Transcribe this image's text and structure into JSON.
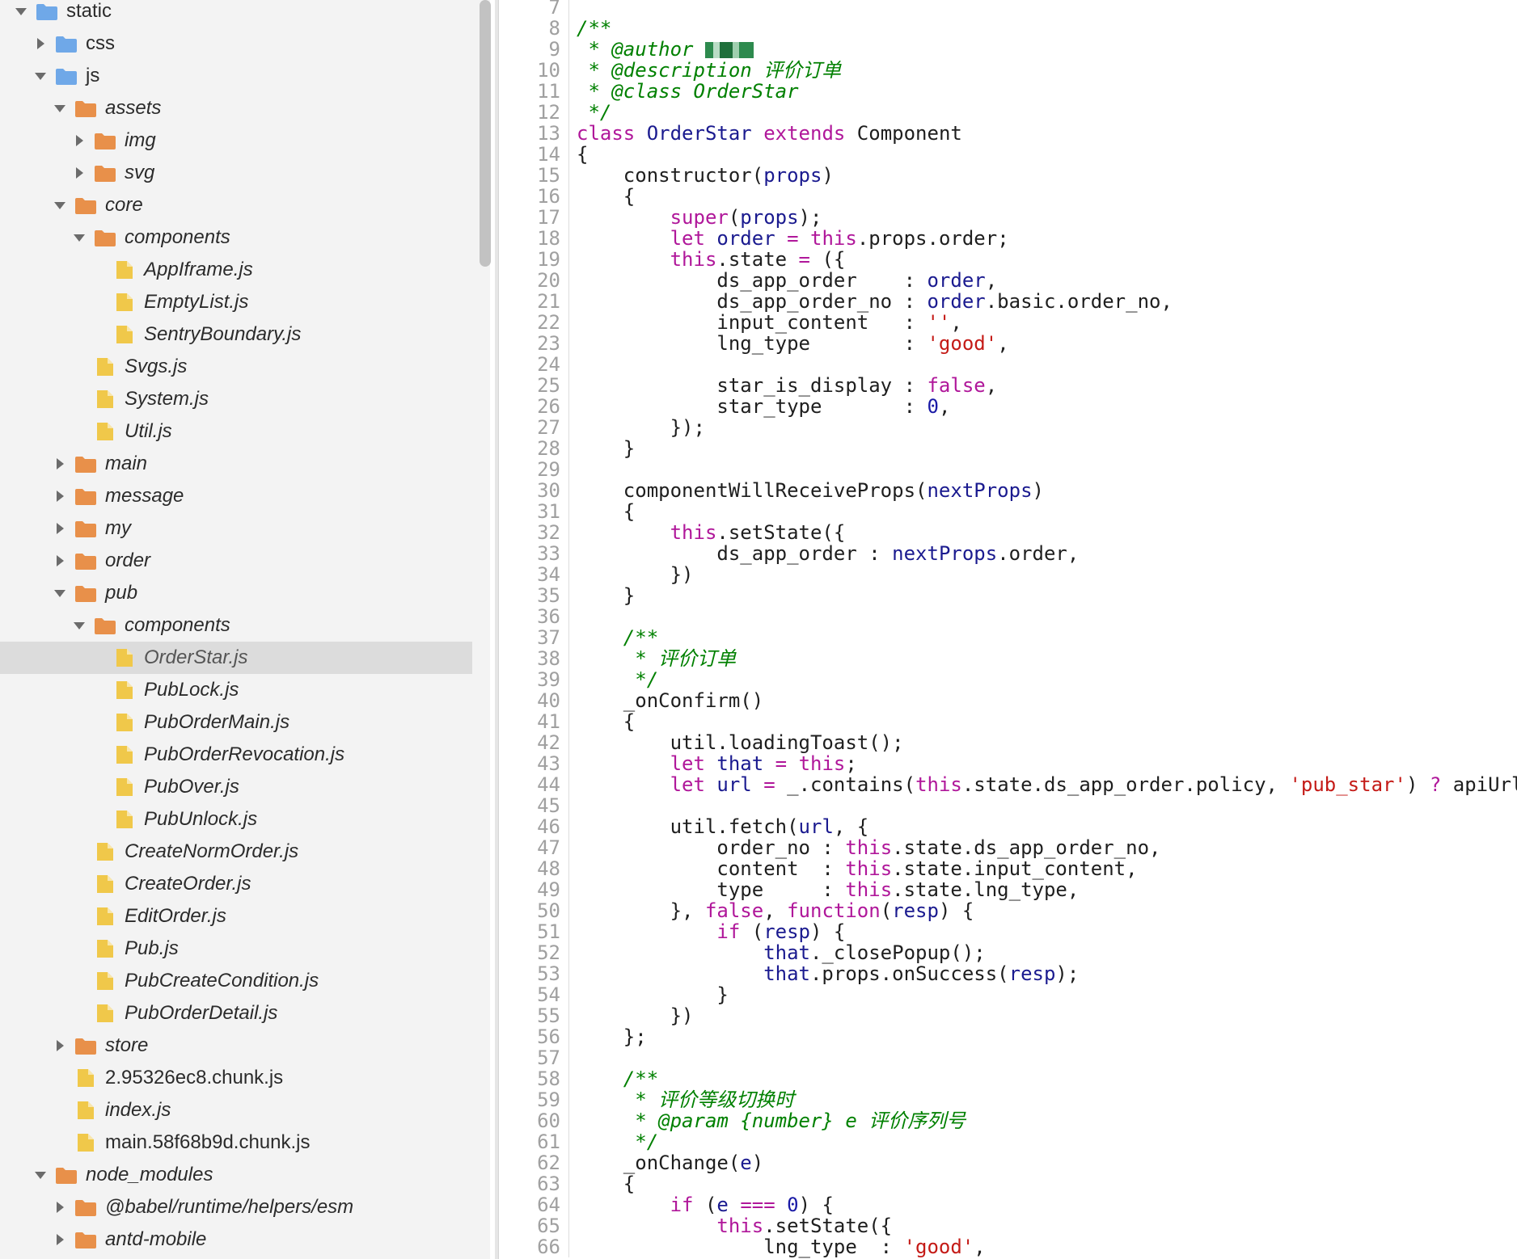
{
  "colors": {
    "folder_blue": "#6fa8e8",
    "folder_orange": "#e8904a",
    "file_yellow": "#f0c84a",
    "comment": "#008000",
    "keyword": "#b0179a",
    "identifier_blue": "#1a1a8f",
    "string": "#c41a16",
    "line_number": "#a0a0a0"
  },
  "file_tree": [
    {
      "label": "static",
      "depth": 0,
      "type": "folder",
      "color": "blue",
      "expanded": true,
      "italic": false
    },
    {
      "label": "css",
      "depth": 1,
      "type": "folder",
      "color": "blue",
      "expanded": false,
      "italic": false
    },
    {
      "label": "js",
      "depth": 1,
      "type": "folder",
      "color": "blue",
      "expanded": true,
      "italic": false
    },
    {
      "label": "assets",
      "depth": 2,
      "type": "folder",
      "color": "orange",
      "expanded": true,
      "italic": true
    },
    {
      "label": "img",
      "depth": 3,
      "type": "folder",
      "color": "orange",
      "expanded": false,
      "italic": true
    },
    {
      "label": "svg",
      "depth": 3,
      "type": "folder",
      "color": "orange",
      "expanded": false,
      "italic": true
    },
    {
      "label": "core",
      "depth": 2,
      "type": "folder",
      "color": "orange",
      "expanded": true,
      "italic": true
    },
    {
      "label": "components",
      "depth": 3,
      "type": "folder",
      "color": "orange",
      "expanded": true,
      "italic": true
    },
    {
      "label": "AppIframe.js",
      "depth": 4,
      "type": "file",
      "italic": true
    },
    {
      "label": "EmptyList.js",
      "depth": 4,
      "type": "file",
      "italic": true
    },
    {
      "label": "SentryBoundary.js",
      "depth": 4,
      "type": "file",
      "italic": true
    },
    {
      "label": "Svgs.js",
      "depth": 3,
      "type": "file",
      "italic": true
    },
    {
      "label": "System.js",
      "depth": 3,
      "type": "file",
      "italic": true
    },
    {
      "label": "Util.js",
      "depth": 3,
      "type": "file",
      "italic": true
    },
    {
      "label": "main",
      "depth": 2,
      "type": "folder",
      "color": "orange",
      "expanded": false,
      "italic": true
    },
    {
      "label": "message",
      "depth": 2,
      "type": "folder",
      "color": "orange",
      "expanded": false,
      "italic": true
    },
    {
      "label": "my",
      "depth": 2,
      "type": "folder",
      "color": "orange",
      "expanded": false,
      "italic": true
    },
    {
      "label": "order",
      "depth": 2,
      "type": "folder",
      "color": "orange",
      "expanded": false,
      "italic": true
    },
    {
      "label": "pub",
      "depth": 2,
      "type": "folder",
      "color": "orange",
      "expanded": true,
      "italic": true
    },
    {
      "label": "components",
      "depth": 3,
      "type": "folder",
      "color": "orange",
      "expanded": true,
      "italic": true
    },
    {
      "label": "OrderStar.js",
      "depth": 4,
      "type": "file",
      "italic": true,
      "selected": true
    },
    {
      "label": "PubLock.js",
      "depth": 4,
      "type": "file",
      "italic": true
    },
    {
      "label": "PubOrderMain.js",
      "depth": 4,
      "type": "file",
      "italic": true
    },
    {
      "label": "PubOrderRevocation.js",
      "depth": 4,
      "type": "file",
      "italic": true
    },
    {
      "label": "PubOver.js",
      "depth": 4,
      "type": "file",
      "italic": true
    },
    {
      "label": "PubUnlock.js",
      "depth": 4,
      "type": "file",
      "italic": true
    },
    {
      "label": "CreateNormOrder.js",
      "depth": 3,
      "type": "file",
      "italic": true
    },
    {
      "label": "CreateOrder.js",
      "depth": 3,
      "type": "file",
      "italic": true
    },
    {
      "label": "EditOrder.js",
      "depth": 3,
      "type": "file",
      "italic": true
    },
    {
      "label": "Pub.js",
      "depth": 3,
      "type": "file",
      "italic": true
    },
    {
      "label": "PubCreateCondition.js",
      "depth": 3,
      "type": "file",
      "italic": true
    },
    {
      "label": "PubOrderDetail.js",
      "depth": 3,
      "type": "file",
      "italic": true
    },
    {
      "label": "store",
      "depth": 2,
      "type": "folder",
      "color": "orange",
      "expanded": false,
      "italic": true
    },
    {
      "label": "2.95326ec8.chunk.js",
      "depth": 2,
      "type": "file",
      "italic": false
    },
    {
      "label": "index.js",
      "depth": 2,
      "type": "file",
      "italic": true
    },
    {
      "label": "main.58f68b9d.chunk.js",
      "depth": 2,
      "type": "file",
      "italic": false
    },
    {
      "label": "node_modules",
      "depth": 1,
      "type": "folder",
      "color": "orange",
      "expanded": true,
      "italic": true
    },
    {
      "label": "@babel/runtime/helpers/esm",
      "depth": 2,
      "type": "folder",
      "color": "orange",
      "expanded": false,
      "italic": true
    },
    {
      "label": "antd-mobile",
      "depth": 2,
      "type": "folder",
      "color": "orange",
      "expanded": false,
      "italic": true
    }
  ],
  "code_lines": [
    {
      "n": "7",
      "tokens": []
    },
    {
      "n": "8",
      "tokens": [
        {
          "t": "cm",
          "v": "/**"
        }
      ]
    },
    {
      "n": "9",
      "tokens": [
        {
          "t": "cm",
          "v": " * @author "
        },
        {
          "t": "redact",
          "v": ""
        }
      ]
    },
    {
      "n": "10",
      "tokens": [
        {
          "t": "cm",
          "v": " * @description 评价订单"
        }
      ]
    },
    {
      "n": "11",
      "tokens": [
        {
          "t": "cm",
          "v": " * @class OrderStar"
        }
      ]
    },
    {
      "n": "12",
      "tokens": [
        {
          "t": "cm",
          "v": " */"
        }
      ]
    },
    {
      "n": "13",
      "tokens": [
        {
          "t": "kw",
          "v": "class"
        },
        {
          "t": "pl",
          "v": " "
        },
        {
          "t": "fn",
          "v": "OrderStar"
        },
        {
          "t": "pl",
          "v": " "
        },
        {
          "t": "kw",
          "v": "extends"
        },
        {
          "t": "pl",
          "v": " Component"
        }
      ]
    },
    {
      "n": "14",
      "tokens": [
        {
          "t": "pl",
          "v": "{"
        }
      ]
    },
    {
      "n": "15",
      "tokens": [
        {
          "t": "pl",
          "v": "    constructor("
        },
        {
          "t": "fn",
          "v": "props"
        },
        {
          "t": "pl",
          "v": ")"
        }
      ]
    },
    {
      "n": "16",
      "tokens": [
        {
          "t": "pl",
          "v": "    {"
        }
      ]
    },
    {
      "n": "17",
      "tokens": [
        {
          "t": "pl",
          "v": "        "
        },
        {
          "t": "kw",
          "v": "super"
        },
        {
          "t": "pl",
          "v": "("
        },
        {
          "t": "fn",
          "v": "props"
        },
        {
          "t": "pl",
          "v": ");"
        }
      ]
    },
    {
      "n": "18",
      "tokens": [
        {
          "t": "pl",
          "v": "        "
        },
        {
          "t": "kw",
          "v": "let"
        },
        {
          "t": "pl",
          "v": " "
        },
        {
          "t": "fn",
          "v": "order"
        },
        {
          "t": "pl",
          "v": " "
        },
        {
          "t": "op",
          "v": "="
        },
        {
          "t": "pl",
          "v": " "
        },
        {
          "t": "kw",
          "v": "this"
        },
        {
          "t": "pl",
          "v": ".props.order;"
        }
      ]
    },
    {
      "n": "19",
      "tokens": [
        {
          "t": "pl",
          "v": "        "
        },
        {
          "t": "kw",
          "v": "this"
        },
        {
          "t": "pl",
          "v": ".state "
        },
        {
          "t": "op",
          "v": "="
        },
        {
          "t": "pl",
          "v": " ({"
        }
      ]
    },
    {
      "n": "20",
      "tokens": [
        {
          "t": "pl",
          "v": "            ds_app_order    : "
        },
        {
          "t": "fn",
          "v": "order"
        },
        {
          "t": "pl",
          "v": ","
        }
      ]
    },
    {
      "n": "21",
      "tokens": [
        {
          "t": "pl",
          "v": "            ds_app_order_no : "
        },
        {
          "t": "fn",
          "v": "order"
        },
        {
          "t": "pl",
          "v": ".basic.order_no,"
        }
      ]
    },
    {
      "n": "22",
      "tokens": [
        {
          "t": "pl",
          "v": "            input_content   : "
        },
        {
          "t": "st",
          "v": "''"
        },
        {
          "t": "pl",
          "v": ","
        }
      ]
    },
    {
      "n": "23",
      "tokens": [
        {
          "t": "pl",
          "v": "            lng_type        : "
        },
        {
          "t": "st",
          "v": "'good'"
        },
        {
          "t": "pl",
          "v": ","
        }
      ]
    },
    {
      "n": "24",
      "tokens": []
    },
    {
      "n": "25",
      "tokens": [
        {
          "t": "pl",
          "v": "            star_is_display : "
        },
        {
          "t": "kw",
          "v": "false"
        },
        {
          "t": "pl",
          "v": ","
        }
      ]
    },
    {
      "n": "26",
      "tokens": [
        {
          "t": "pl",
          "v": "            star_type       : "
        },
        {
          "t": "nm",
          "v": "0"
        },
        {
          "t": "pl",
          "v": ","
        }
      ]
    },
    {
      "n": "27",
      "tokens": [
        {
          "t": "pl",
          "v": "        });"
        }
      ]
    },
    {
      "n": "28",
      "tokens": [
        {
          "t": "pl",
          "v": "    }"
        }
      ]
    },
    {
      "n": "29",
      "tokens": []
    },
    {
      "n": "30",
      "tokens": [
        {
          "t": "pl",
          "v": "    componentWillReceiveProps("
        },
        {
          "t": "fn",
          "v": "nextProps"
        },
        {
          "t": "pl",
          "v": ")"
        }
      ]
    },
    {
      "n": "31",
      "tokens": [
        {
          "t": "pl",
          "v": "    {"
        }
      ]
    },
    {
      "n": "32",
      "tokens": [
        {
          "t": "pl",
          "v": "        "
        },
        {
          "t": "kw",
          "v": "this"
        },
        {
          "t": "pl",
          "v": ".setState({"
        }
      ]
    },
    {
      "n": "33",
      "tokens": [
        {
          "t": "pl",
          "v": "            ds_app_order : "
        },
        {
          "t": "fn",
          "v": "nextProps"
        },
        {
          "t": "pl",
          "v": ".order,"
        }
      ]
    },
    {
      "n": "34",
      "tokens": [
        {
          "t": "pl",
          "v": "        })"
        }
      ]
    },
    {
      "n": "35",
      "tokens": [
        {
          "t": "pl",
          "v": "    }"
        }
      ]
    },
    {
      "n": "36",
      "tokens": []
    },
    {
      "n": "37",
      "tokens": [
        {
          "t": "cm",
          "v": "    /**"
        }
      ]
    },
    {
      "n": "38",
      "tokens": [
        {
          "t": "cm",
          "v": "     * 评价订单"
        }
      ]
    },
    {
      "n": "39",
      "tokens": [
        {
          "t": "cm",
          "v": "     */"
        }
      ]
    },
    {
      "n": "40",
      "tokens": [
        {
          "t": "pl",
          "v": "    _onConfirm()"
        }
      ]
    },
    {
      "n": "41",
      "tokens": [
        {
          "t": "pl",
          "v": "    {"
        }
      ]
    },
    {
      "n": "42",
      "tokens": [
        {
          "t": "pl",
          "v": "        util.loadingToast();"
        }
      ]
    },
    {
      "n": "43",
      "tokens": [
        {
          "t": "pl",
          "v": "        "
        },
        {
          "t": "kw",
          "v": "let"
        },
        {
          "t": "pl",
          "v": " "
        },
        {
          "t": "fn",
          "v": "that"
        },
        {
          "t": "pl",
          "v": " "
        },
        {
          "t": "op",
          "v": "="
        },
        {
          "t": "pl",
          "v": " "
        },
        {
          "t": "kw",
          "v": "this"
        },
        {
          "t": "pl",
          "v": ";"
        }
      ]
    },
    {
      "n": "44",
      "tokens": [
        {
          "t": "pl",
          "v": "        "
        },
        {
          "t": "kw",
          "v": "let"
        },
        {
          "t": "pl",
          "v": " "
        },
        {
          "t": "fn",
          "v": "url"
        },
        {
          "t": "pl",
          "v": " "
        },
        {
          "t": "op",
          "v": "="
        },
        {
          "t": "pl",
          "v": " _.contains("
        },
        {
          "t": "kw",
          "v": "this"
        },
        {
          "t": "pl",
          "v": ".state.ds_app_order.policy, "
        },
        {
          "t": "st",
          "v": "'pub_star'"
        },
        {
          "t": "pl",
          "v": ") "
        },
        {
          "t": "op",
          "v": "?"
        },
        {
          "t": "pl",
          "v": " apiUrl"
        }
      ]
    },
    {
      "n": "45",
      "tokens": []
    },
    {
      "n": "46",
      "tokens": [
        {
          "t": "pl",
          "v": "        util.fetch("
        },
        {
          "t": "fn",
          "v": "url"
        },
        {
          "t": "pl",
          "v": ", {"
        }
      ]
    },
    {
      "n": "47",
      "tokens": [
        {
          "t": "pl",
          "v": "            order_no : "
        },
        {
          "t": "kw",
          "v": "this"
        },
        {
          "t": "pl",
          "v": ".state.ds_app_order_no,"
        }
      ]
    },
    {
      "n": "48",
      "tokens": [
        {
          "t": "pl",
          "v": "            content  : "
        },
        {
          "t": "kw",
          "v": "this"
        },
        {
          "t": "pl",
          "v": ".state.input_content,"
        }
      ]
    },
    {
      "n": "49",
      "tokens": [
        {
          "t": "pl",
          "v": "            type     : "
        },
        {
          "t": "kw",
          "v": "this"
        },
        {
          "t": "pl",
          "v": ".state.lng_type,"
        }
      ]
    },
    {
      "n": "50",
      "tokens": [
        {
          "t": "pl",
          "v": "        }, "
        },
        {
          "t": "kw",
          "v": "false"
        },
        {
          "t": "pl",
          "v": ", "
        },
        {
          "t": "kw",
          "v": "function"
        },
        {
          "t": "pl",
          "v": "("
        },
        {
          "t": "fn",
          "v": "resp"
        },
        {
          "t": "pl",
          "v": ") {"
        }
      ]
    },
    {
      "n": "51",
      "tokens": [
        {
          "t": "pl",
          "v": "            "
        },
        {
          "t": "kw",
          "v": "if"
        },
        {
          "t": "pl",
          "v": " ("
        },
        {
          "t": "fn",
          "v": "resp"
        },
        {
          "t": "pl",
          "v": ") {"
        }
      ]
    },
    {
      "n": "52",
      "tokens": [
        {
          "t": "pl",
          "v": "                "
        },
        {
          "t": "fn",
          "v": "that"
        },
        {
          "t": "pl",
          "v": "._closePopup();"
        }
      ]
    },
    {
      "n": "53",
      "tokens": [
        {
          "t": "pl",
          "v": "                "
        },
        {
          "t": "fn",
          "v": "that"
        },
        {
          "t": "pl",
          "v": ".props.onSuccess("
        },
        {
          "t": "fn",
          "v": "resp"
        },
        {
          "t": "pl",
          "v": ");"
        }
      ]
    },
    {
      "n": "54",
      "tokens": [
        {
          "t": "pl",
          "v": "            }"
        }
      ]
    },
    {
      "n": "55",
      "tokens": [
        {
          "t": "pl",
          "v": "        })"
        }
      ]
    },
    {
      "n": "56",
      "tokens": [
        {
          "t": "pl",
          "v": "    };"
        }
      ]
    },
    {
      "n": "57",
      "tokens": []
    },
    {
      "n": "58",
      "tokens": [
        {
          "t": "cm",
          "v": "    /**"
        }
      ]
    },
    {
      "n": "59",
      "tokens": [
        {
          "t": "cm",
          "v": "     * 评价等级切换时"
        }
      ]
    },
    {
      "n": "60",
      "tokens": [
        {
          "t": "cm",
          "v": "     * @param {number} e 评价序列号"
        }
      ]
    },
    {
      "n": "61",
      "tokens": [
        {
          "t": "cm",
          "v": "     */"
        }
      ]
    },
    {
      "n": "62",
      "tokens": [
        {
          "t": "pl",
          "v": "    _onChange("
        },
        {
          "t": "fn",
          "v": "e"
        },
        {
          "t": "pl",
          "v": ")"
        }
      ]
    },
    {
      "n": "63",
      "tokens": [
        {
          "t": "pl",
          "v": "    {"
        }
      ]
    },
    {
      "n": "64",
      "tokens": [
        {
          "t": "pl",
          "v": "        "
        },
        {
          "t": "kw",
          "v": "if"
        },
        {
          "t": "pl",
          "v": " ("
        },
        {
          "t": "fn",
          "v": "e"
        },
        {
          "t": "pl",
          "v": " "
        },
        {
          "t": "op",
          "v": "==="
        },
        {
          "t": "pl",
          "v": " "
        },
        {
          "t": "nm",
          "v": "0"
        },
        {
          "t": "pl",
          "v": ") {"
        }
      ]
    },
    {
      "n": "65",
      "tokens": [
        {
          "t": "pl",
          "v": "            "
        },
        {
          "t": "kw",
          "v": "this"
        },
        {
          "t": "pl",
          "v": ".setState({"
        }
      ]
    },
    {
      "n": "66",
      "tokens": [
        {
          "t": "pl",
          "v": "                lng_type  : "
        },
        {
          "t": "st",
          "v": "'good'"
        },
        {
          "t": "pl",
          "v": ","
        }
      ]
    }
  ]
}
